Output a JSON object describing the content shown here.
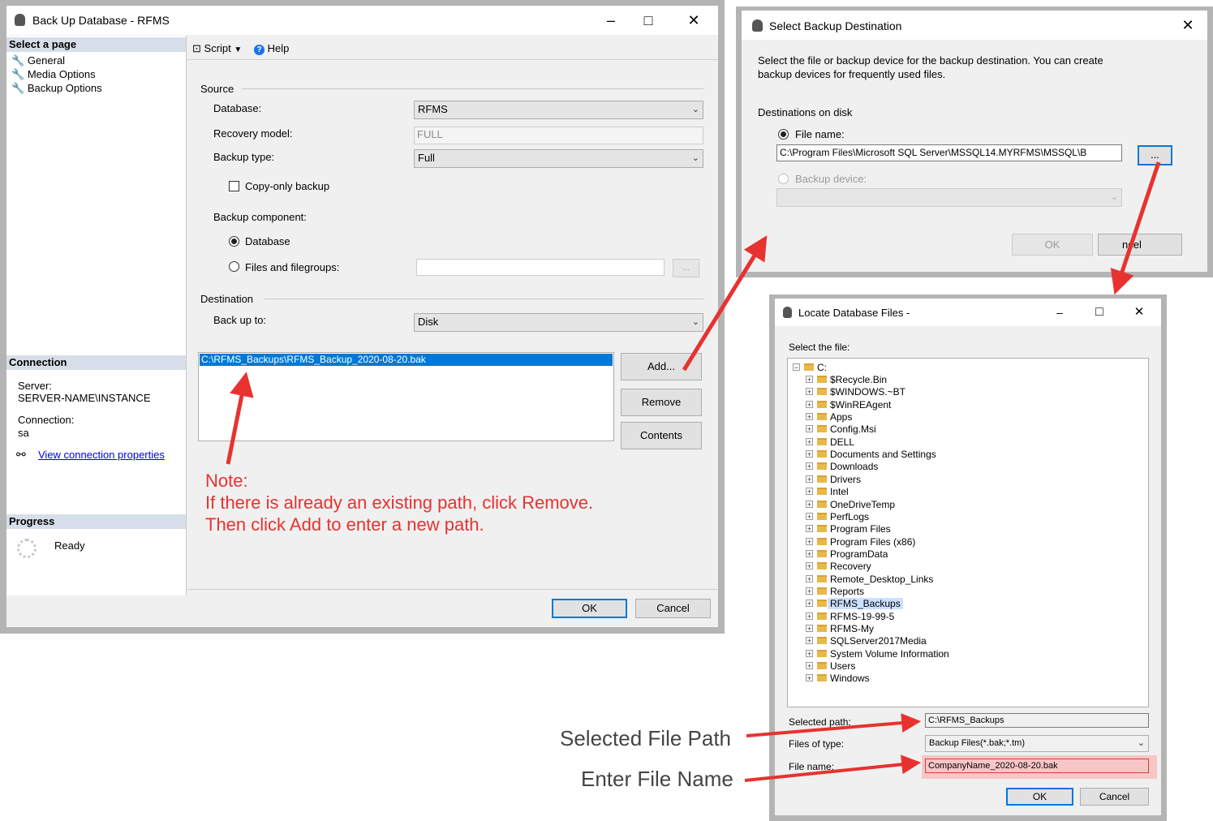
{
  "backup_dialog": {
    "title": "Back Up Database - RFMS",
    "select_page_header": "Select a page",
    "pages": [
      "General",
      "Media Options",
      "Backup Options"
    ],
    "toolbar": {
      "script": "Script",
      "help": "Help"
    },
    "source_label": "Source",
    "database_label": "Database:",
    "database_value": "RFMS",
    "recovery_model_label": "Recovery model:",
    "recovery_model_value": "FULL",
    "backup_type_label": "Backup type:",
    "backup_type_value": "Full",
    "copy_only_label": "Copy-only backup",
    "backup_component_label": "Backup component:",
    "component_database": "Database",
    "component_files": "Files and filegroups:",
    "files_browse": "...",
    "destination_label": "Destination",
    "backup_to_label": "Back up to:",
    "backup_to_value": "Disk",
    "destination_path": "C:\\RFMS_Backups\\RFMS_Backup_2020-08-20.bak",
    "add_button": "Add...",
    "remove_button": "Remove",
    "contents_button": "Contents",
    "connection_header": "Connection",
    "server_label": "Server:",
    "server_value": "SERVER-NAME\\INSTANCE",
    "connection_label": "Connection:",
    "connection_value": "sa",
    "view_connection_link": "View connection properties",
    "progress_header": "Progress",
    "progress_status": "Ready",
    "ok": "OK",
    "cancel": "Cancel"
  },
  "note": {
    "line1": "Note:",
    "line2": "If there is already an existing path, click Remove.",
    "line3": "Then click Add to enter a new path."
  },
  "select_dest_dialog": {
    "title": "Select Backup Destination",
    "description_line1": "Select the file or backup device for the backup destination. You can create",
    "description_line2": "backup devices for frequently used files.",
    "destinations_label": "Destinations on disk",
    "file_name_label": "File name:",
    "file_name_value": "C:\\Program Files\\Microsoft SQL Server\\MSSQL14.MYRFMS\\MSSQL\\B",
    "browse": "...",
    "backup_device_label": "Backup device:",
    "ok": "OK",
    "cancel": "ncel"
  },
  "locate_dialog": {
    "title": "Locate Database Files -",
    "select_file_label": "Select the file:",
    "root": "C:",
    "folders": [
      "$Recycle.Bin",
      "$WINDOWS.~BT",
      "$WinREAgent",
      "Apps",
      "Config.Msi",
      "DELL",
      "Documents and Settings",
      "Downloads",
      "Drivers",
      "Intel",
      "OneDriveTemp",
      "PerfLogs",
      "Program Files",
      "Program Files (x86)",
      "ProgramData",
      "Recovery",
      "Remote_Desktop_Links",
      "Reports",
      "RFMS_Backups",
      "RFMS-19-99-5",
      "RFMS-My",
      "SQLServer2017Media",
      "System Volume Information",
      "Users",
      "Windows"
    ],
    "selected_folder": "RFMS_Backups",
    "selected_path_label": "Selected path:",
    "selected_path_value": "C:\\RFMS_Backups",
    "files_of_type_label": "Files of type:",
    "files_of_type_value": "Backup Files(*.bak;*.tm)",
    "file_name_label": "File name:",
    "file_name_value": "CompanyName_2020-08-20.bak",
    "ok": "OK",
    "cancel": "Cancel"
  },
  "callouts": {
    "selected_file_path": "Selected File Path",
    "enter_file_name": "Enter File Name"
  },
  "colors": {
    "annotation_red": "#e8322f",
    "selection_blue": "#0078d7",
    "panel_header": "#d6dfe9",
    "filename_highlight": "#f8c6c6"
  }
}
